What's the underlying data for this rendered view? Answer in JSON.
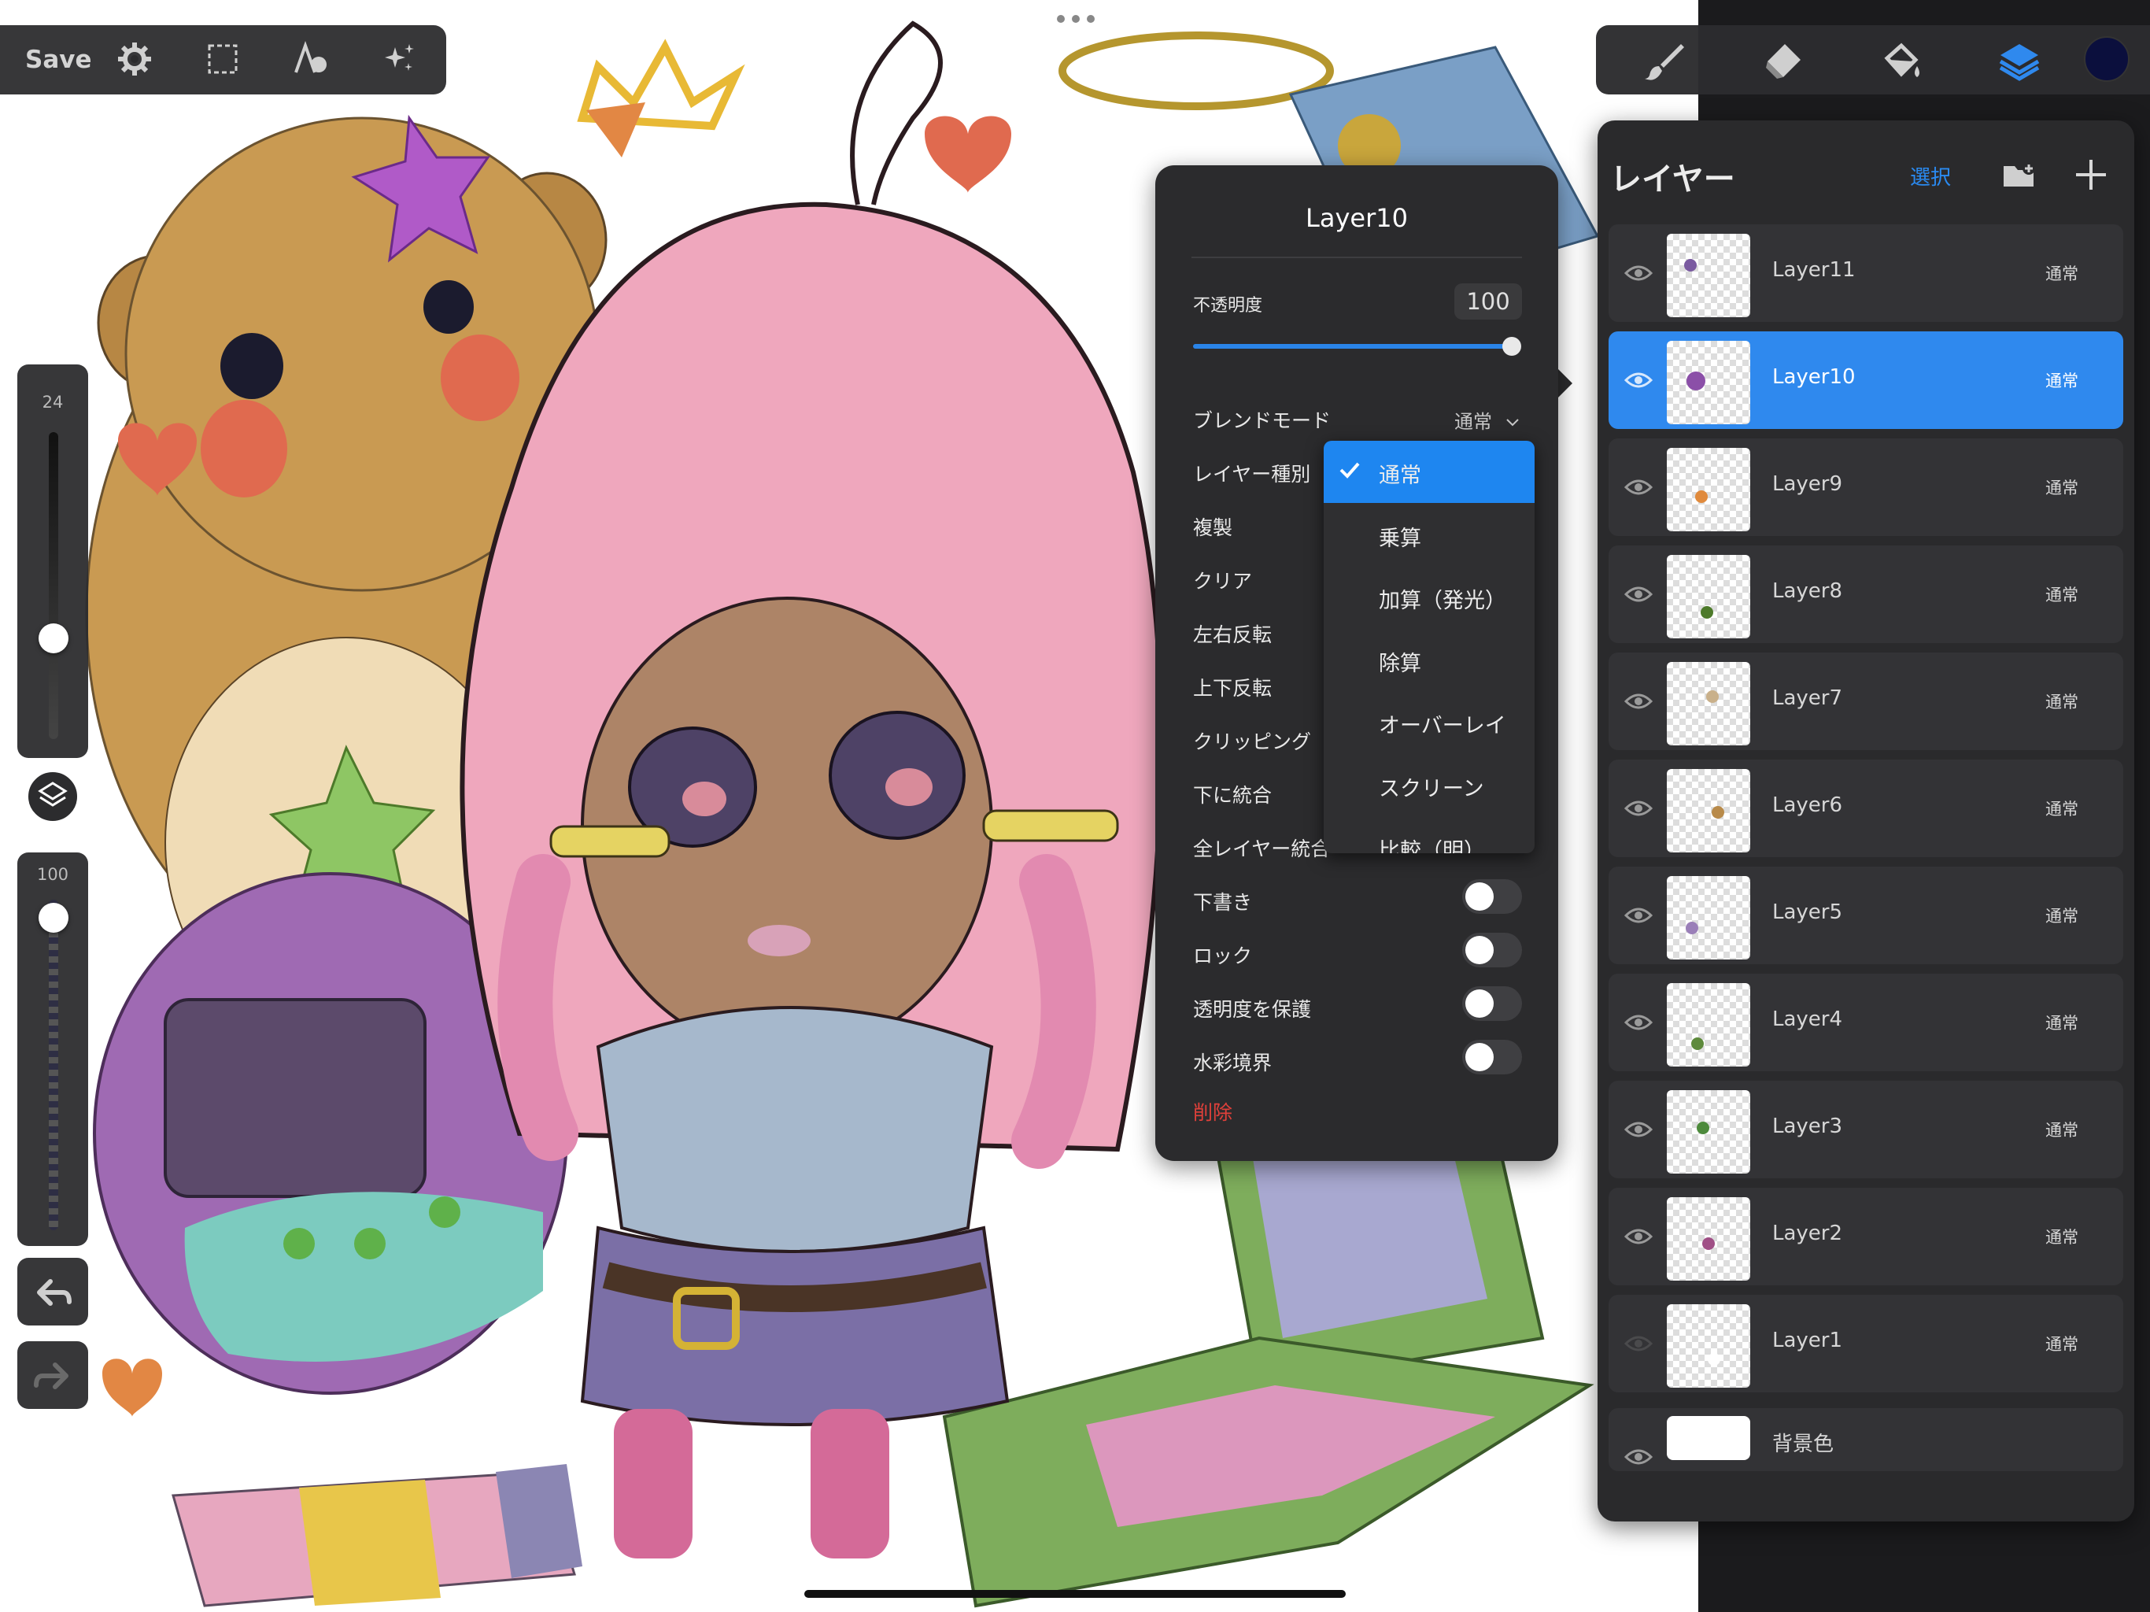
{
  "toolbar_left": {
    "save_label": "Save",
    "icons": [
      "gear-icon",
      "selection-icon",
      "adjustments-icon",
      "magic-wand-icon"
    ]
  },
  "toolbar_right": {
    "icons": [
      "brush-icon",
      "eraser-icon",
      "fill-bucket-icon",
      "layers-icon"
    ],
    "current_color": "#0b0f3d",
    "accent": "#2f89ee"
  },
  "sidebar": {
    "brush_size_value": "24",
    "brush_size_level": 0.38,
    "opacity_value": "100",
    "opacity_level": 0.97,
    "icons": [
      "modify-square-icon",
      "undo-icon",
      "redo-icon"
    ]
  },
  "layer_options": {
    "title": "Layer10",
    "opacity_label": "不透明度",
    "opacity_value": "100",
    "opacity_level": 1.0,
    "blend_label": "ブレンドモード",
    "blend_value": "通常",
    "layer_type_label": "レイヤー種別",
    "duplicate": "複製",
    "clear": "クリア",
    "flip_horizontal": "左右反転",
    "flip_vertical": "上下反転",
    "clipping": "クリッピング",
    "merge_down": "下に統合",
    "merge_all": "全レイヤー統合",
    "draft": "下書き",
    "lock": "ロック",
    "preserve_transparency": "透明度を保護",
    "watercolor_edge": "水彩境界",
    "delete": "削除",
    "toggles": {
      "draft": false,
      "lock": false,
      "preserve_transparency": false,
      "watercolor_edge": false
    }
  },
  "layer_type_menu": {
    "items": [
      "通常",
      "乗算",
      "加算（発光）",
      "除算",
      "オーバーレイ",
      "スクリーン",
      "比較（明）"
    ],
    "selected": "通常"
  },
  "layers_panel": {
    "title": "レイヤー",
    "select_label": "選択",
    "icons": [
      "new-folder-icon",
      "add-layer-icon"
    ],
    "layers": [
      {
        "name": "Layer11",
        "mode": "通常",
        "visible": true,
        "active": false
      },
      {
        "name": "Layer10",
        "mode": "通常",
        "visible": true,
        "active": true
      },
      {
        "name": "Layer9",
        "mode": "通常",
        "visible": true,
        "active": false
      },
      {
        "name": "Layer8",
        "mode": "通常",
        "visible": true,
        "active": false
      },
      {
        "name": "Layer7",
        "mode": "通常",
        "visible": true,
        "active": false
      },
      {
        "name": "Layer6",
        "mode": "通常",
        "visible": true,
        "active": false
      },
      {
        "name": "Layer5",
        "mode": "通常",
        "visible": true,
        "active": false
      },
      {
        "name": "Layer4",
        "mode": "通常",
        "visible": true,
        "active": false
      },
      {
        "name": "Layer3",
        "mode": "通常",
        "visible": true,
        "active": false
      },
      {
        "name": "Layer2",
        "mode": "通常",
        "visible": true,
        "active": false
      },
      {
        "name": "Layer1",
        "mode": "通常",
        "visible": false,
        "active": false
      }
    ],
    "background_layer": {
      "name": "背景色",
      "visible": true
    }
  }
}
